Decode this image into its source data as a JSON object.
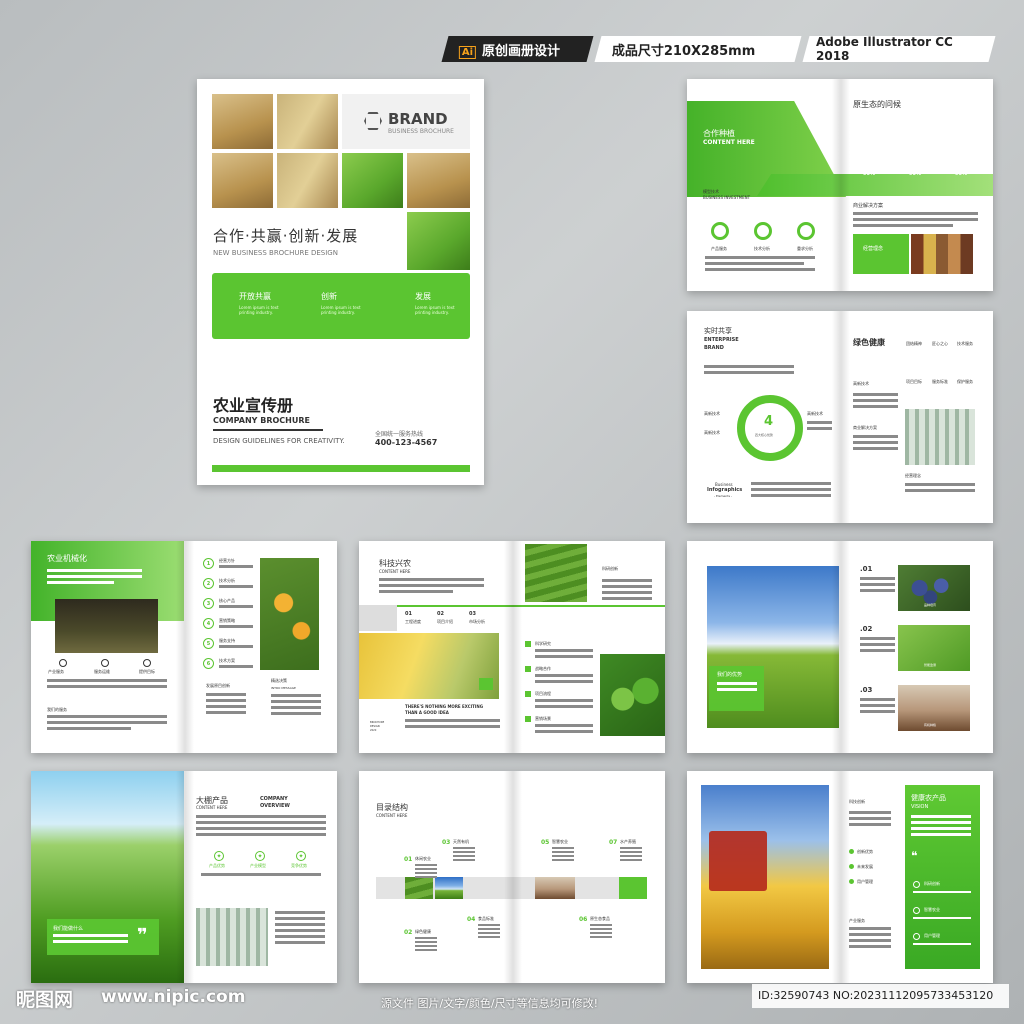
{
  "badges": {
    "ai_tag": "Ai",
    "original": "原创画册设计",
    "size": "成品尺寸210X285mm",
    "software": "Adobe Illustrator CC 2018"
  },
  "cover": {
    "brand": "BRAND",
    "brand_sub": "BUSINESS BROCHURE",
    "slogan": "合作·共赢·创新·发展",
    "slogan_en": "NEW BUSINESS  BROCHURE DESIGN",
    "features": [
      {
        "title": "开放共赢",
        "desc": "Lorem ipsum is text printing industry."
      },
      {
        "title": "创新",
        "desc": "Lorem ipsum is text printing industry."
      },
      {
        "title": "发展",
        "desc": "Lorem ipsum is text printing industry."
      }
    ],
    "title_cn": "农业宣传册",
    "title_en": "COMPANY BROCHURE",
    "tagline": "DESIGN GUIDELINES FOR CREATIVITY.",
    "hotline_label": "全国统一服务热线",
    "hotline": "400-123-4567"
  },
  "spread1": {
    "left_title": "合作种植",
    "left_sub": "CONTENT HERE",
    "small_title": "模型技术",
    "small_sub": "BUSINESS INVESTMENT",
    "rings": [
      {
        "label": "产品服务"
      },
      {
        "label": "技术分析"
      },
      {
        "label": "重求分析"
      }
    ],
    "right_title": "原生态的问候",
    "stats": [
      "90%",
      "90%",
      "90%"
    ],
    "right_label": "商业解决方案",
    "banner": "经营理念"
  },
  "spread2": {
    "title": "实时共享",
    "sub1": "ENTERPRISE",
    "sub2": "BRAND",
    "center_num": "4",
    "center_label": "四大核心优势",
    "side_labels": [
      "高新技术",
      "高新技术",
      "高新技术"
    ],
    "foot1": "Business",
    "foot2": "Infographics",
    "foot3": "- Elements -",
    "right_title": "绿色健康",
    "icons": [
      {
        "label": "团结精神"
      },
      {
        "label": "匠心之心"
      },
      {
        "label": "技术服务"
      },
      {
        "label": "项目目标"
      },
      {
        "label": "服务标准"
      },
      {
        "label": "保护服务"
      }
    ],
    "r_label1": "高新技术",
    "r_label2": "商业解决方案",
    "r_label3": "经营理念"
  },
  "spread3": {
    "title": "农业机械化",
    "icons": [
      {
        "label": "产业服务"
      },
      {
        "label": "服务运维"
      },
      {
        "label": "提供目标"
      }
    ],
    "left_label": "我们的服务",
    "list": [
      "经营方针",
      "技术分析",
      "核心产品",
      "营销策略",
      "服务支持",
      "技术方案"
    ],
    "right_label": "发展原目创新",
    "quote_label": "精选决策",
    "quote_sub": "INTRO MESSAGE"
  },
  "spread4": {
    "title": "科技兴农",
    "sub": "CONTENT HERE",
    "nums": [
      "01",
      "02",
      "03"
    ],
    "tabs": [
      "工程进度",
      "项目介绍",
      "市场分析"
    ],
    "caption1": "THERE'S NOTHING MORE EXCITING",
    "caption2": "THAN A GOOD IDEA",
    "mini1": "BROCHURE",
    "mini2": "DESIGN",
    "mini3": "2020",
    "right_title": "科研创新",
    "list": [
      "科学研究",
      "战略合作",
      "项目流程",
      "营销场景"
    ]
  },
  "spread5": {
    "banner": "我们的优势",
    "items": [
      {
        "num": ".01",
        "cap": "品种培育"
      },
      {
        "num": ".02",
        "cap": "智能监测"
      },
      {
        "num": ".03",
        "cap": "有机种植"
      }
    ]
  },
  "spread6": {
    "quote": "我们能做什么",
    "title": "大棚产品",
    "sub": "CONTENT HERE",
    "title2": "COMPANY",
    "title2b": "OVERVIEW",
    "icons": [
      {
        "label": "产品优势"
      },
      {
        "label": "产业模型"
      },
      {
        "label": "竞争优势"
      }
    ]
  },
  "spread7": {
    "title": "目录结构",
    "sub": "CONTENT HERE",
    "chapters": [
      {
        "num": "01",
        "title": "休闲农业"
      },
      {
        "num": "02",
        "title": "绿色健康"
      },
      {
        "num": "03",
        "title": "天然有机"
      },
      {
        "num": "04",
        "title": "食品标准"
      },
      {
        "num": "05",
        "title": "智慧农业"
      },
      {
        "num": "06",
        "title": "原生态食品"
      },
      {
        "num": "07",
        "title": "水产养殖"
      }
    ]
  },
  "spread8": {
    "title": "健康农产品",
    "sub": "VISION",
    "left_title": "科技创新",
    "list": [
      "创新优势",
      "未来发展",
      "用户管理"
    ],
    "label2": "产业服务",
    "right_items": [
      "科研创新",
      "智慧农业",
      "用户管理"
    ]
  },
  "footer": {
    "logo": "昵图网",
    "url": "www.nipic.com",
    "note": "源文件 图片/文字/颜色/尺寸等信息均可修改!",
    "id": "ID:32590743 NO:20231112095733453120"
  }
}
